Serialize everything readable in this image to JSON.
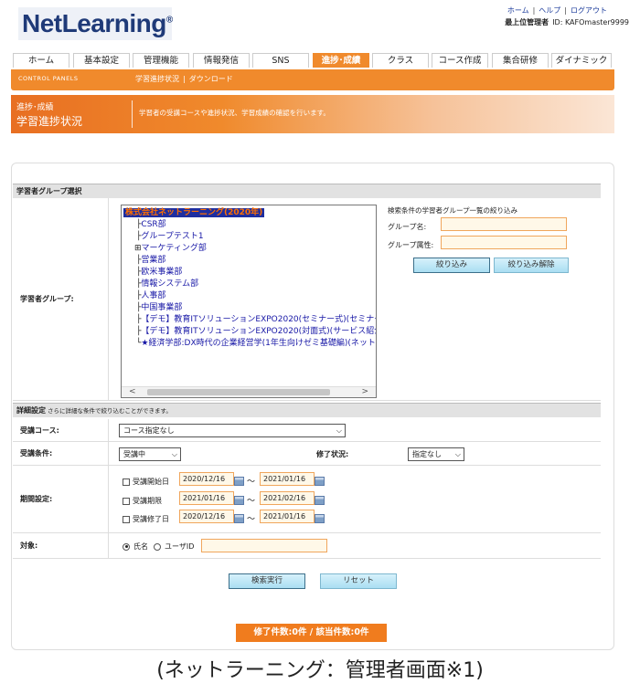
{
  "header": {
    "logo": "NetLearning",
    "links": [
      "ホーム",
      "ヘルプ",
      "ログアウト"
    ],
    "admin_label": "最上位管理者",
    "admin_id": "ID: KAFOmaster9999"
  },
  "nav": {
    "tabs": [
      "ホーム",
      "基本設定",
      "管理機能",
      "情報発信",
      "SNS",
      "進捗･成績",
      "クラス",
      "コース作成",
      "集合研修",
      "ダイナミック"
    ],
    "active": "進捗･成績"
  },
  "control_panel": {
    "label": "CONTROL PANELS",
    "links": [
      "学習進捗状況",
      "ダウンロード"
    ]
  },
  "page_head": {
    "subtitle": "進捗･成績",
    "title": "学習進捗状況",
    "description": "学習者の受講コースや進捗状況、学習成績の確認を行います。"
  },
  "group_section": {
    "title": "学習者グループ選択",
    "row_label": "学習者グループ:",
    "tree": [
      {
        "text": "株式会社ネットラーニング(2020年)",
        "pre": "",
        "selected": true
      },
      {
        "text": "CSR部",
        "pre": "├"
      },
      {
        "text": "グループテスト1",
        "pre": "├"
      },
      {
        "text": "マーケティング部",
        "pre": "⊞"
      },
      {
        "text": "営業部",
        "pre": "├"
      },
      {
        "text": "欧米事業部",
        "pre": "├"
      },
      {
        "text": "情報システム部",
        "pre": "├"
      },
      {
        "text": "人事部",
        "pre": "├"
      },
      {
        "text": "中国事業部",
        "pre": "├"
      },
      {
        "text": "【デモ】教育ITソリューションEXPO2020(セミナー式)(セミナー式講師",
        "pre": "├"
      },
      {
        "text": "【デモ】教育ITソリューションEXPO2020(対面式)(サービス紹介)",
        "pre": "├"
      },
      {
        "text": "★経済学部:DX時代の企業経営学(1年生向けゼミ基礎編)(ネットラ",
        "pre": "└"
      }
    ],
    "filter_title": "検索条件の学習者グループ一覧の絞り込み",
    "group_name_label": "グループ名:",
    "group_attr_label": "グループ属性:",
    "filter_button": "絞り込み",
    "clear_button": "絞り込み解除"
  },
  "detail_section": {
    "title": "詳細設定",
    "note": "さらに詳細な条件で絞り込むことができます。",
    "course_label": "受講コース:",
    "course_value": "コース指定なし",
    "condition_label": "受講条件:",
    "condition_value": "受講中",
    "completion_label": "修了状況:",
    "completion_value": "指定なし",
    "period_label": "期間設定:",
    "periods": [
      {
        "label": "受講開始日",
        "from": "2020/12/16",
        "to": "2021/01/16"
      },
      {
        "label": "受講期限",
        "from": "2021/01/16",
        "to": "2021/02/16"
      },
      {
        "label": "受講修了日",
        "from": "2020/12/16",
        "to": "2021/01/16"
      }
    ],
    "target_label": "対象:",
    "radio_name": "氏名",
    "radio_userid": "ユーザID"
  },
  "actions": {
    "search": "検索実行",
    "reset": "リセット"
  },
  "counts": "修了件数:0件 / 該当件数:0件",
  "caption": "(ネットラーニング：管理者画面※1)"
}
